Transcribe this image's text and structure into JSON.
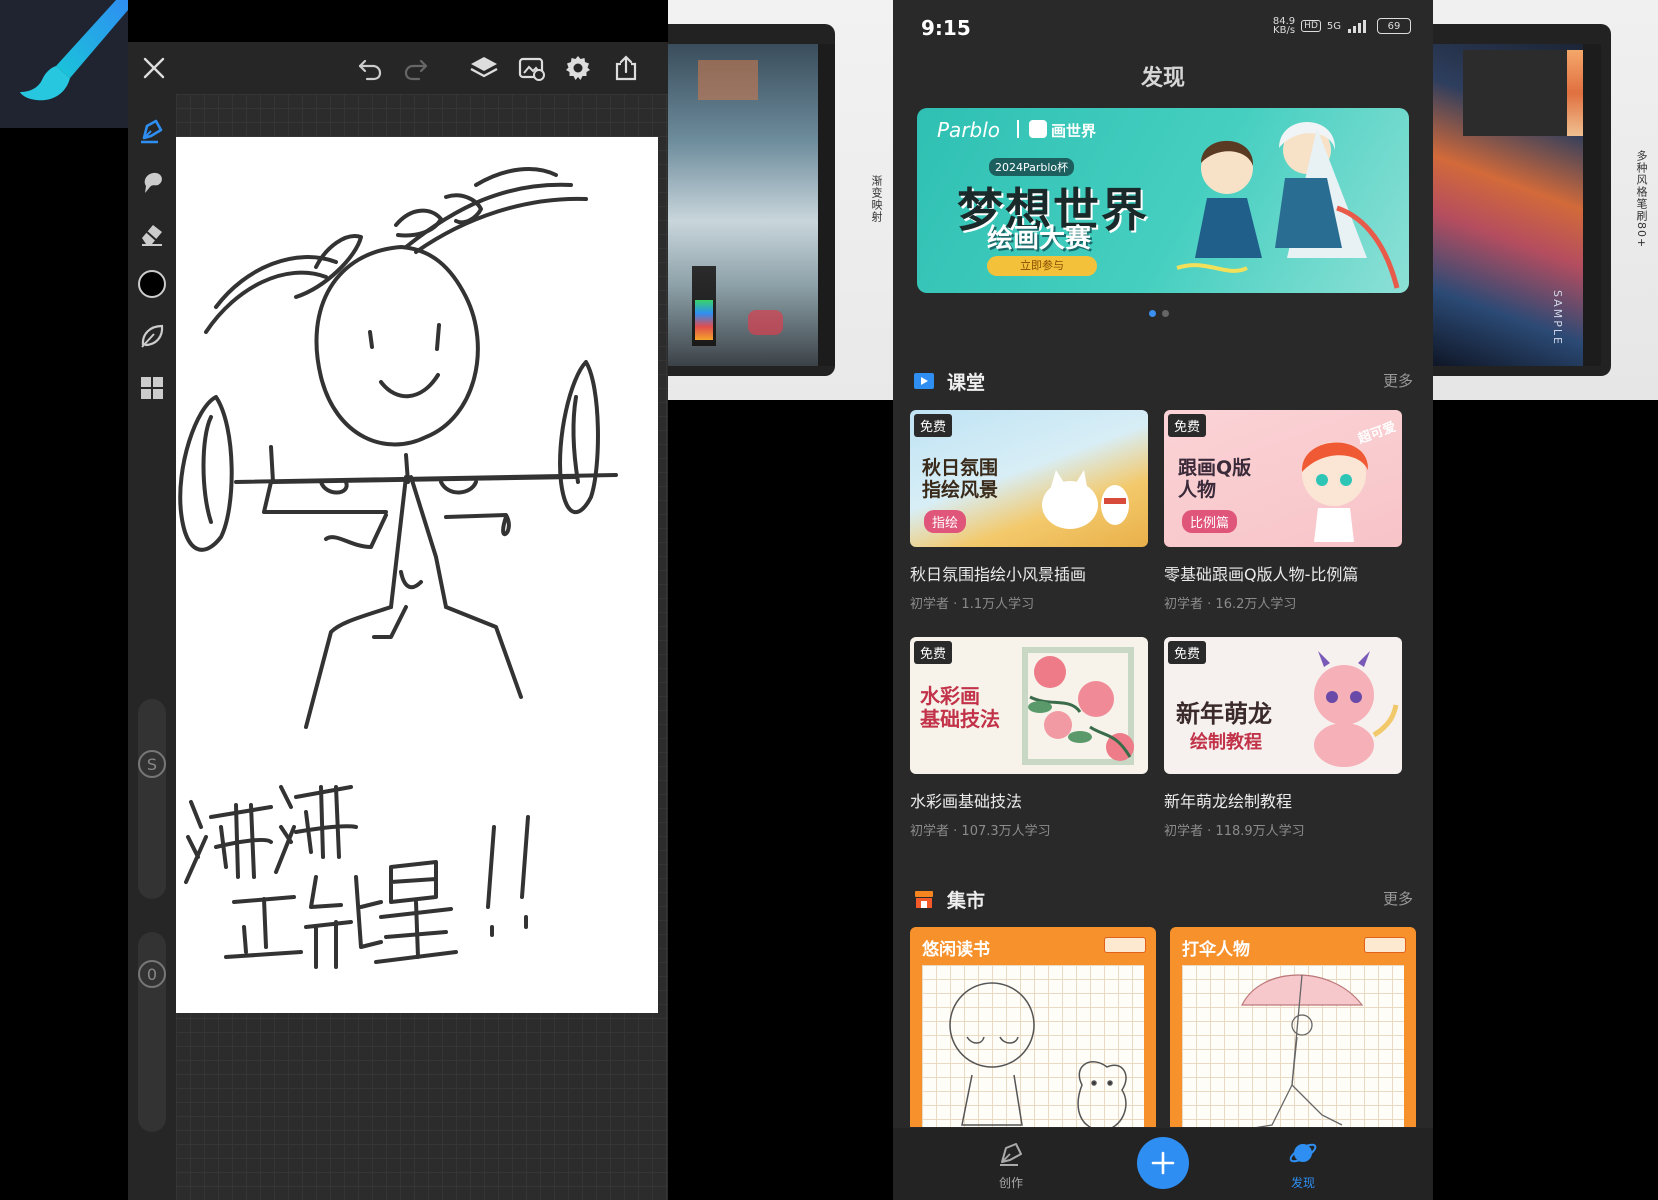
{
  "editor": {
    "toolbar": {
      "close_icon": "close-icon",
      "undo_icon": "undo-icon",
      "redo_icon": "redo-icon",
      "layers_icon": "layers-icon",
      "import_icon": "import-image-icon",
      "settings_icon": "gear-icon",
      "share_icon": "share-icon"
    },
    "tools": [
      "pen-icon",
      "smudge-icon",
      "eraser-icon",
      "color-swatch",
      "leaf-brush-icon",
      "grid-layout-icon"
    ],
    "slider_size_label": "S",
    "slider_opacity_label": "0",
    "drawing_text_line1": "满满",
    "drawing_text_line2": "正能量!!",
    "active_tool_color": "#2f8ef2",
    "current_color": "#000000"
  },
  "promo_strips": {
    "left_label": "渐变映射",
    "right_label": "多种风格笔刷80+",
    "watermark": "SAMPLE"
  },
  "phone": {
    "status": {
      "time": "9:15",
      "speed": "84.9",
      "speed_unit": "KB/s",
      "hd": "HD",
      "network": "5G",
      "battery": "69"
    },
    "title": "发现",
    "banner": {
      "brand1": "Parblo",
      "brand2": "画世界",
      "subtitle": "2024Parblo杯",
      "headline": "梦想世界",
      "subheadline": "绘画大赛",
      "cta": "立即参与",
      "dots": 2,
      "active_dot": 0
    },
    "classroom": {
      "title": "课堂",
      "more": "更多",
      "courses": [
        {
          "badge": "免费",
          "thumb_text": "秋日氛围\n指绘风景",
          "thumb_tag": "指绘",
          "title": "秋日氛围指绘小风景插画",
          "level": "初学者",
          "learners": "1.1万人学习"
        },
        {
          "badge": "免费",
          "thumb_text": "跟画Q版\n人物",
          "thumb_tag": "比例篇",
          "corner_text": "超可爱",
          "title": "零基础跟画Q版人物-比例篇",
          "level": "初学者",
          "learners": "16.2万人学习"
        },
        {
          "badge": "免费",
          "thumb_text": "水彩画\n基础技法",
          "title": "水彩画基础技法",
          "level": "初学者",
          "learners": "107.3万人学习"
        },
        {
          "badge": "免费",
          "thumb_text": "新年萌龙",
          "thumb_sub": "绘制教程",
          "title": "新年萌龙绘制教程",
          "level": "初学者",
          "learners": "118.9万人学习"
        }
      ]
    },
    "market": {
      "title": "集市",
      "more": "更多",
      "items": [
        {
          "title": "悠闲读书"
        },
        {
          "title": "打伞人物"
        }
      ]
    },
    "nav": {
      "create_label": "创作",
      "discover_label": "发现",
      "accent": "#2f8ef2"
    }
  }
}
